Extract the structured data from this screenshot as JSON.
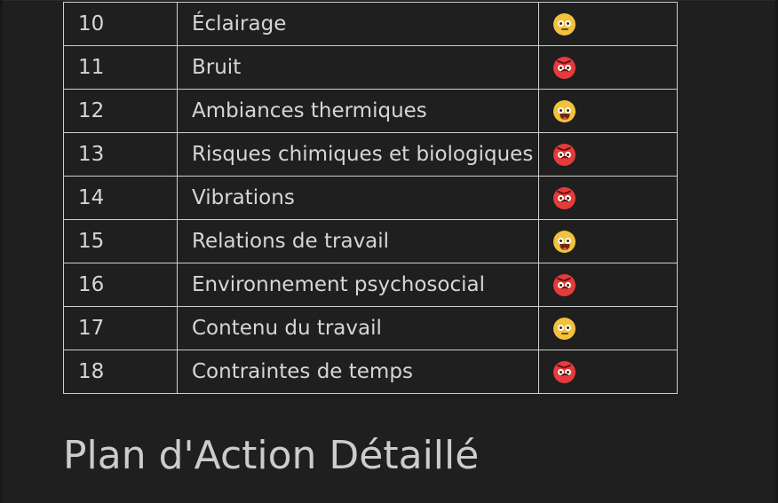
{
  "rating_table": {
    "rows": [
      {
        "number": "10",
        "label": "Éclairage",
        "rating": "neutral-face-icon"
      },
      {
        "number": "11",
        "label": "Bruit",
        "rating": "angry-face-icon"
      },
      {
        "number": "12",
        "label": "Ambiances thermiques",
        "rating": "happy-face-icon"
      },
      {
        "number": "13",
        "label": "Risques chimiques et biologiques",
        "rating": "angry-face-icon"
      },
      {
        "number": "14",
        "label": "Vibrations",
        "rating": "angry-face-icon"
      },
      {
        "number": "15",
        "label": "Relations de travail",
        "rating": "happy-face-icon"
      },
      {
        "number": "16",
        "label": "Environnement psychosocial",
        "rating": "angry-face-icon"
      },
      {
        "number": "17",
        "label": "Contenu du travail",
        "rating": "neutral-face-icon"
      },
      {
        "number": "18",
        "label": "Contraintes de temps",
        "rating": "angry-face-icon"
      }
    ],
    "rating_colors": {
      "neutral": "#f3c23b",
      "happy": "#f3c23b",
      "angry": "#e63b3b"
    }
  },
  "section": {
    "title": "Plan d'Action Détaillé"
  },
  "theme": {
    "background": "#1f1f1f",
    "text": "#d6d6d6",
    "border": "#cfcfcf"
  }
}
